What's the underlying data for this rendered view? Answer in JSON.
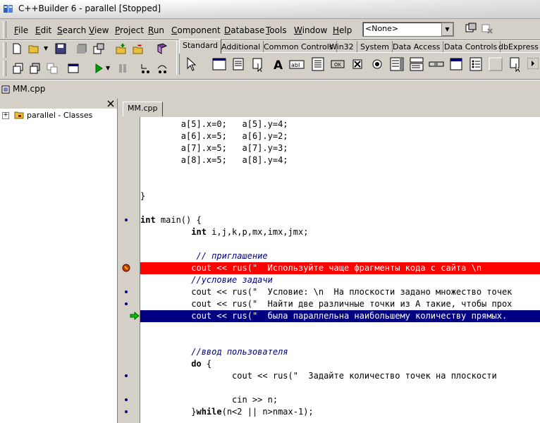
{
  "window": {
    "title": "C++Builder 6 - parallel [Stopped]"
  },
  "menu": {
    "items": [
      {
        "label": "File",
        "ul": "F"
      },
      {
        "label": "Edit",
        "ul": "E"
      },
      {
        "label": "Search",
        "ul": "S"
      },
      {
        "label": "View",
        "ul": "V"
      },
      {
        "label": "Project",
        "ul": "P"
      },
      {
        "label": "Run",
        "ul": "R"
      },
      {
        "label": "Component",
        "ul": "C"
      },
      {
        "label": "Database",
        "ul": "D"
      },
      {
        "label": "Tools",
        "ul": "T"
      },
      {
        "label": "Window",
        "ul": "W"
      },
      {
        "label": "Help",
        "ul": "H"
      }
    ]
  },
  "desktop_combo": {
    "value": "<None>"
  },
  "palette": {
    "tabs": [
      "Standard",
      "Additional",
      "Common Controls",
      "Win32",
      "System",
      "Data Access",
      "Data Controls",
      "dbExpress"
    ],
    "active": "Standard"
  },
  "project_file": "MM.cpp",
  "class_tree": {
    "root": "parallel - Classes"
  },
  "editor": {
    "tab": "MM.cpp",
    "lines": [
      {
        "text": "        a[5].x=0;   a[5].y=4;",
        "style": "normal"
      },
      {
        "text": "        a[6].x=5;   a[6].y=2;",
        "style": "normal"
      },
      {
        "text": "        a[7].x=5;   a[7].y=3;",
        "style": "normal"
      },
      {
        "text": "        a[8].x=5;   a[8].y=4;",
        "style": "normal"
      },
      {
        "text": "",
        "style": "normal"
      },
      {
        "text": "",
        "style": "normal"
      },
      {
        "text": "}",
        "style": "normal"
      },
      {
        "text": "",
        "style": "normal"
      },
      {
        "text": "int main() {",
        "style": "normal"
      },
      {
        "text": "          int i,j,k,p,mx,imx,jmx;",
        "style": "normal"
      },
      {
        "text": "",
        "style": "normal"
      },
      {
        "text": "           // приглашение",
        "style": "comment"
      },
      {
        "text": "          cout << rus(\"  Используйте чаще фрагменты кода с сайта \\n",
        "style": "red"
      },
      {
        "text": "          //условие задачи",
        "style": "comment"
      },
      {
        "text": "          cout << rus(\"  Условие: \\n  На плоскости задано множество точек",
        "style": "normal"
      },
      {
        "text": "          cout << rus(\"  Найти две различные точки из А такие, чтобы прох",
        "style": "normal"
      },
      {
        "text": "          cout << rus(\"  была параллельна наибольшему количеству прямых.",
        "style": "blue"
      },
      {
        "text": "",
        "style": "normal"
      },
      {
        "text": "",
        "style": "normal"
      },
      {
        "text": "          //ввод пользователя",
        "style": "comment"
      },
      {
        "text": "          do {",
        "style": "normal"
      },
      {
        "text": "                  cout << rus(\"  Задайте количество точек на плоскости",
        "style": "normal"
      },
      {
        "text": "",
        "style": "normal"
      },
      {
        "text": "                  cin >> n;",
        "style": "normal"
      },
      {
        "text": "          }while(n<2 || n>nmax-1);",
        "style": "normal"
      }
    ]
  },
  "colors": {
    "breakpoint": "#ff0000",
    "execution_point": "#000080",
    "comment": "#000080"
  }
}
